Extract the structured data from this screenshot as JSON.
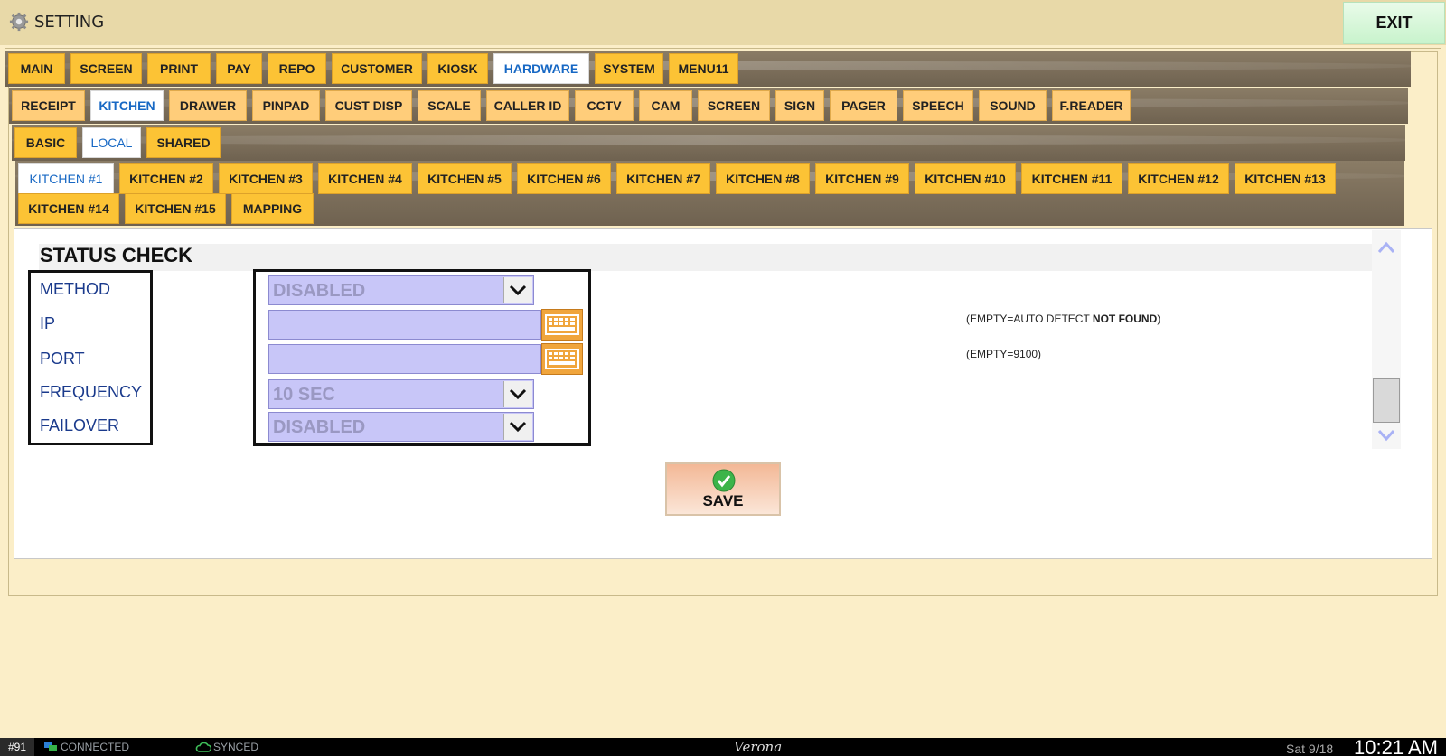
{
  "window": {
    "title": "SETTING",
    "exit_label": "EXIT"
  },
  "main_tabs": [
    "MAIN",
    "SCREEN",
    "PRINT",
    "PAY",
    "REPO",
    "CUSTOMER",
    "KIOSK",
    "HARDWARE",
    "SYSTEM",
    "MENU11"
  ],
  "main_tabs_active": "HARDWARE",
  "hardware_tabs": [
    "RECEIPT",
    "KITCHEN",
    "DRAWER",
    "PINPAD",
    "CUST DISP",
    "SCALE",
    "CALLER ID",
    "CCTV",
    "CAM",
    "SCREEN",
    "SIGN",
    "PAGER",
    "SPEECH",
    "SOUND",
    "F.READER"
  ],
  "hardware_tabs_active": "KITCHEN",
  "mode_tabs": [
    "BASIC",
    "LOCAL",
    "SHARED"
  ],
  "mode_tabs_active": "LOCAL",
  "kitchen_tabs": [
    "KITCHEN #1",
    "KITCHEN #2",
    "KITCHEN #3",
    "KITCHEN #4",
    "KITCHEN #5",
    "KITCHEN #6",
    "KITCHEN #7",
    "KITCHEN #8",
    "KITCHEN #9",
    "KITCHEN #10",
    "KITCHEN #11",
    "KITCHEN #12",
    "KITCHEN #13",
    "KITCHEN #14",
    "KITCHEN #15",
    "MAPPING"
  ],
  "kitchen_tabs_active": "KITCHEN #1",
  "section": {
    "title": "STATUS CHECK",
    "labels": {
      "method": "METHOD",
      "ip": "IP",
      "port": "PORT",
      "frequency": "FREQUENCY",
      "failover": "FAILOVER"
    },
    "values": {
      "method": "DISABLED",
      "ip": "",
      "port": "",
      "frequency": "10 SEC",
      "failover": "DISABLED"
    },
    "hints": {
      "ip_prefix": "(EMPTY=AUTO DETECT ",
      "ip_status": "NOT FOUND",
      "ip_suffix": ")",
      "port": "(EMPTY=9100)"
    }
  },
  "save_label": "SAVE",
  "status_bar": {
    "station": "#91",
    "connection": "CONNECTED",
    "sync": "SYNCED",
    "store": "Verona",
    "date": "Sat 9/18",
    "time": "10:21 AM"
  }
}
